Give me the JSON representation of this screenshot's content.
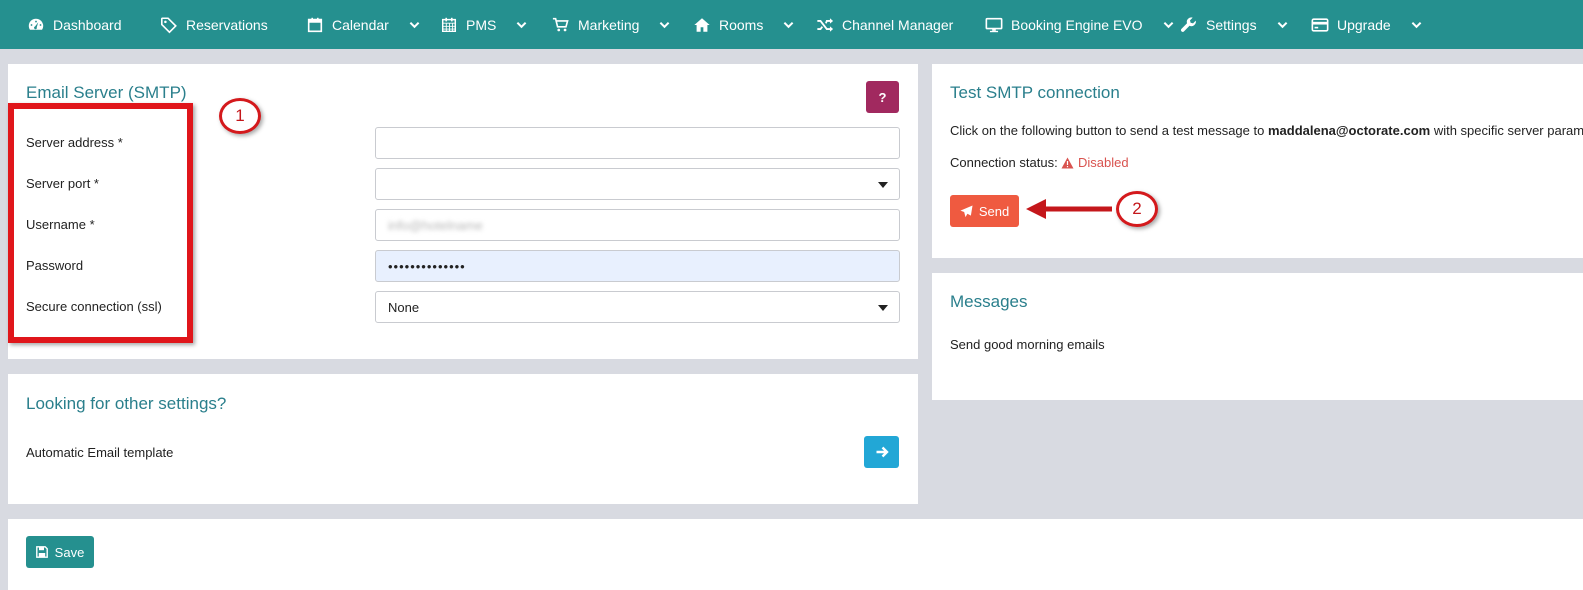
{
  "navbar": {
    "items": [
      {
        "label": "Dashboard",
        "icon": "dashboard-icon",
        "dropdown": false
      },
      {
        "label": "Reservations",
        "icon": "tag-icon",
        "dropdown": false
      },
      {
        "label": "Calendar",
        "icon": "calendar-icon",
        "dropdown": true
      },
      {
        "label": "PMS",
        "icon": "grid-calendar-icon",
        "dropdown": true
      },
      {
        "label": "Marketing",
        "icon": "cart-icon",
        "dropdown": true
      },
      {
        "label": "Rooms",
        "icon": "home-icon",
        "dropdown": true
      },
      {
        "label": "Channel Manager",
        "icon": "shuffle-icon",
        "dropdown": false
      },
      {
        "label": "Booking Engine EVO",
        "icon": "monitor-icon",
        "dropdown": true
      },
      {
        "label": "Settings",
        "icon": "wrench-icon",
        "dropdown": true
      },
      {
        "label": "Upgrade",
        "icon": "credit-card-icon",
        "dropdown": true
      }
    ]
  },
  "smtp": {
    "title": "Email Server (SMTP)",
    "help_label": "?",
    "fields": {
      "server_address": {
        "label": "Server address  *",
        "value": ""
      },
      "server_port": {
        "label": "Server port  *",
        "value": ""
      },
      "username": {
        "label": "Username  *",
        "value": "info@hotelname"
      },
      "password": {
        "label": "Password",
        "value": "••••••••••••••"
      },
      "secure": {
        "label": "Secure connection (ssl)",
        "value": "None"
      }
    }
  },
  "other_settings": {
    "title": "Looking for other settings?",
    "item_label": "Automatic Email template"
  },
  "test": {
    "title": "Test SMTP connection",
    "desc_prefix": "Click on the following button to send a test message to ",
    "email": "maddalena@octorate.com",
    "desc_suffix": " with specific server parameters.",
    "status_label": "Connection status:",
    "status_value": "Disabled",
    "send_label": "Send"
  },
  "messages": {
    "title": "Messages",
    "text": "Send good morning emails"
  },
  "footer": {
    "save_label": "Save"
  },
  "annotations": {
    "badge_1": "1",
    "badge_2": "2"
  },
  "colors": {
    "navbar": "#25908f",
    "title": "#2a7f8c",
    "help": "#a1295f",
    "arrow": "#22a7d6",
    "send": "#ef5a40",
    "danger": "#d9534f",
    "annotation_red": "#e0161b"
  }
}
